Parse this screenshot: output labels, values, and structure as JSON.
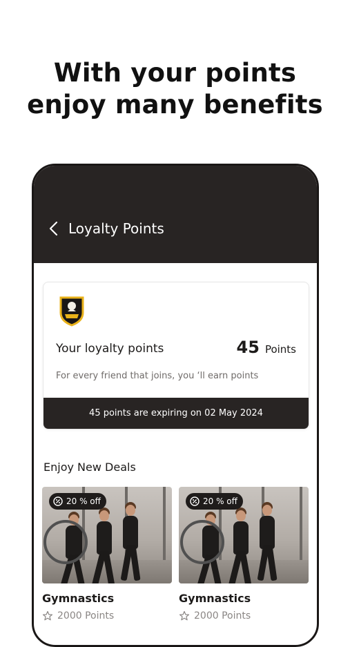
{
  "headline": {
    "line1": "With your points",
    "line2": "enjoy many benefits"
  },
  "appbar": {
    "title": "Loyalty Points",
    "back_icon": "chevron-left-icon"
  },
  "loyalty_card": {
    "label": "Your loyalty points",
    "points_value": "45",
    "points_unit": "Points",
    "note": "For every friend that joins, you ‘ll earn points",
    "expiry": "45 points are expiring on 02 May 2024"
  },
  "deals": {
    "title": "Enjoy New Deals",
    "items": [
      {
        "badge": "20 % off",
        "name": "Gymnastics",
        "points": "2000 Points"
      },
      {
        "badge": "20 % off",
        "name": "Gymnastics",
        "points": "2000 Points"
      }
    ]
  },
  "colors": {
    "dark": "#282423",
    "text": "#1c1a19",
    "muted": "#8a8684",
    "accent_logo": "#e9b21a"
  }
}
